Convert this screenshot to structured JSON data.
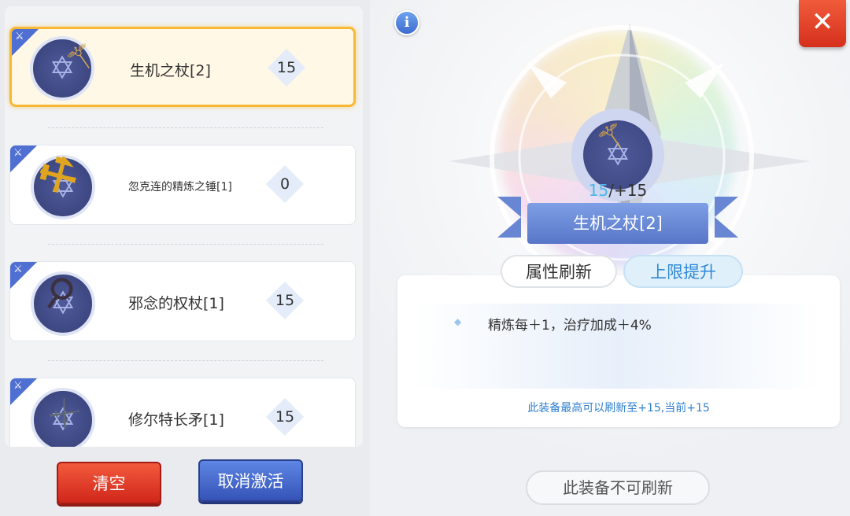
{
  "equipment_list": [
    {
      "name": "生机之杖[2]",
      "level": "15",
      "selected": true,
      "weapon_icon": "staff-icon"
    },
    {
      "name": "忽克连的精炼之锤[1]",
      "level": "0",
      "selected": false,
      "weapon_icon": "hammer-icon"
    },
    {
      "name": "邪念的权杖[1]",
      "level": "15",
      "selected": false,
      "weapon_icon": "scepter-icon"
    },
    {
      "name": "修尔特长矛[1]",
      "level": "15",
      "selected": false,
      "weapon_icon": "spear-icon"
    }
  ],
  "buttons": {
    "clear": "清空",
    "cancel_activate": "取消激活",
    "not_refreshable": "此装备不可刷新",
    "close": "✕",
    "info": "i"
  },
  "detail": {
    "refine_current": "15",
    "refine_max": "/+15",
    "item_name": "生机之杖[2]",
    "tabs": [
      "属性刷新",
      "上限提升"
    ],
    "active_tab": "上限提升",
    "effect_text": "精炼每＋1，治疗加成＋4%",
    "max_note": "此装备最高可以刷新至+15,当前+15"
  },
  "colors": {
    "selected_border": "#f7b935",
    "clear_button": "#d0261b",
    "cancel_button": "#3553b7",
    "ribbon": "#6886d3",
    "note_text": "#2f7fcf"
  }
}
